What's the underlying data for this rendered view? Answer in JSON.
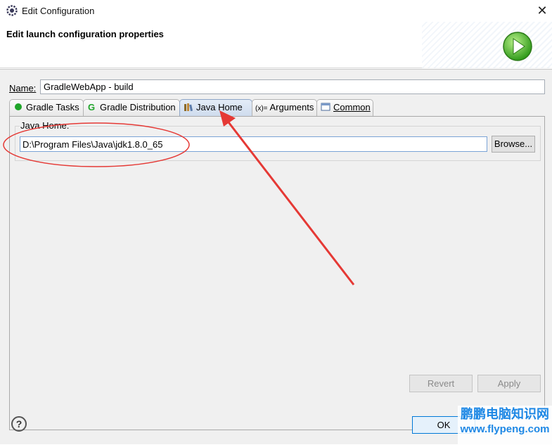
{
  "window": {
    "title": "Edit Configuration",
    "close_glyph": "✕"
  },
  "header": {
    "title": "Edit launch configuration properties",
    "icon": "run-icon"
  },
  "name_field": {
    "label": "Name:",
    "value": "GradleWebApp - build"
  },
  "tabs": [
    {
      "label": "Gradle Tasks",
      "icon": "green-dot-icon",
      "active": false
    },
    {
      "label": "Gradle Distribution",
      "icon": "gradle-g-icon",
      "active": false
    },
    {
      "label": "Java Home",
      "icon": "books-icon",
      "active": true
    },
    {
      "label": "Arguments",
      "icon": "variables-icon",
      "prefix": "(x)=",
      "active": false
    },
    {
      "label": "Common",
      "icon": "window-icon",
      "active": false
    }
  ],
  "java_home": {
    "group_label": "Java Home:",
    "value": "D:\\Program Files\\Java\\jdk1.8.0_65",
    "browse_label": "Browse..."
  },
  "buttons": {
    "revert": "Revert",
    "apply": "Apply",
    "ok": "OK",
    "help": "?"
  },
  "watermark": {
    "line1": "鹏鹏电脑知识网",
    "line2": "www.flypeng.com"
  },
  "colors": {
    "accent": "#0078d7",
    "annotation": "#e53935",
    "watermark": "#1e88e5"
  }
}
